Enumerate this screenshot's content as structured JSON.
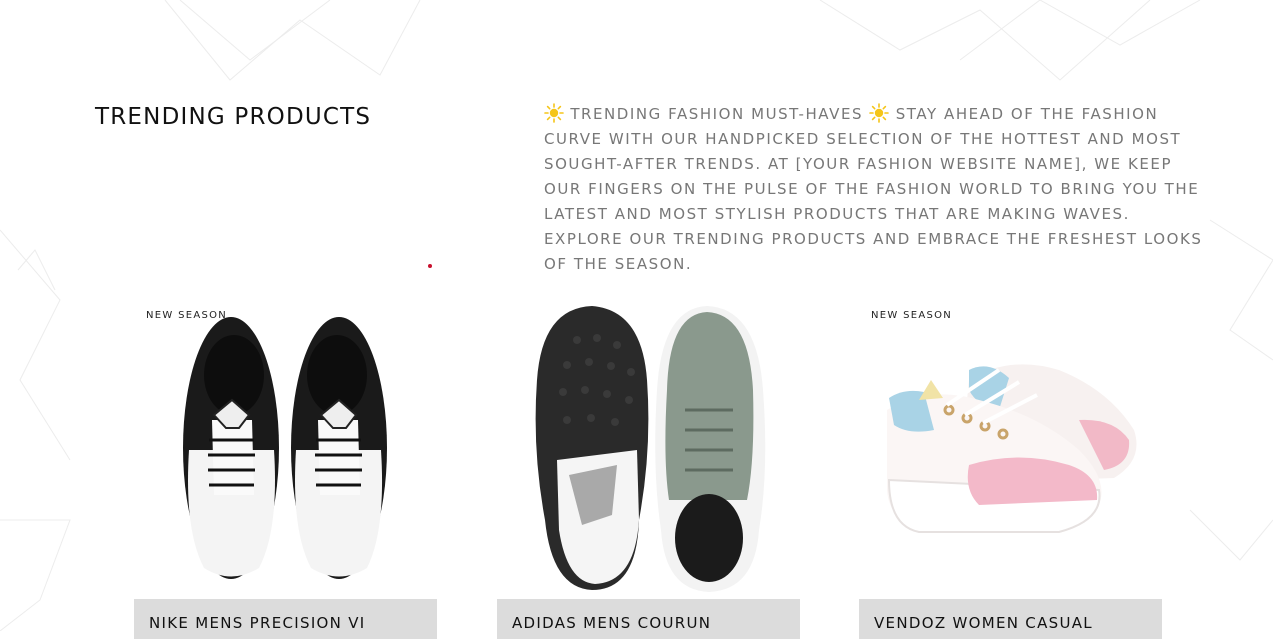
{
  "section": {
    "title": "TRENDING PRODUCTS"
  },
  "intro": {
    "icon": "sun-icon",
    "line1": "TRENDING FASHION MUST-HAVES",
    "line2": "STAY AHEAD OF THE FASHION CURVE WITH OUR HANDPICKED SELECTION OF THE HOTTEST AND MOST SOUGHT-AFTER TRENDS. AT [YOUR FASHION WEBSITE NAME], WE KEEP OUR FINGERS ON THE PULSE OF THE FASHION WORLD TO BRING YOU THE LATEST AND MOST STYLISH PRODUCTS THAT ARE MAKING WAVES. EXPLORE OUR TRENDING PRODUCTS AND EMBRACE THE FRESHEST LOOKS OF THE SEASON."
  },
  "colors": {
    "accent_dot": "#c8102e",
    "name_bar": "#dcdcdc",
    "intro_text": "#777777"
  },
  "products": [
    {
      "badge": "NEW SEASON",
      "name": "NIKE MENS PRECISION VI",
      "image": "black-white-sneakers"
    },
    {
      "badge": "",
      "name": "ADIDAS MENS COURUN",
      "image": "grey-running-shoes"
    },
    {
      "badge": "NEW SEASON",
      "name": "VENDOZ WOMEN CASUAL",
      "image": "pastel-chunky-sneakers"
    }
  ]
}
